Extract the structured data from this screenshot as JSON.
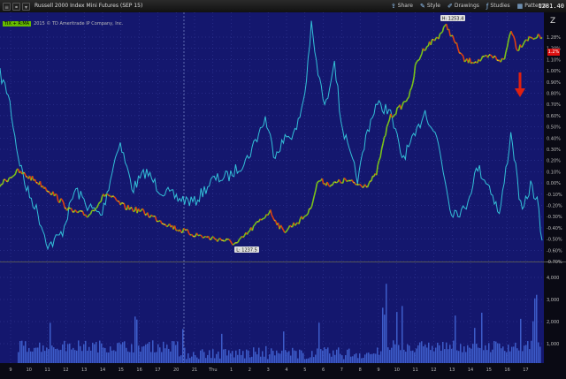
{
  "window": {
    "title": "Russell 2000 Index Mini Futures (SEP 15)",
    "last_price": "1281.40",
    "buttons": [
      {
        "label": "Share",
        "icon": "share-icon",
        "glyph": "⇪"
      },
      {
        "label": "Style",
        "icon": "style-icon",
        "glyph": "✎"
      },
      {
        "label": "Drawings",
        "icon": "drawings-icon",
        "glyph": "✐"
      },
      {
        "label": "Studies",
        "icon": "studies-icon",
        "glyph": "ƒ"
      },
      {
        "label": "Patterns",
        "icon": "patterns-icon",
        "glyph": "▦"
      }
    ]
  },
  "study": {
    "badge": "TIX + R:MA",
    "copyright": "2015 © TD Ameritrade IP Company, Inc."
  },
  "price_tag": "1.2%",
  "high_label": "H: 1253.4",
  "low_label": "L: 1237.5",
  "chart_data": {
    "type": "line",
    "y_axis_ticks": [
      "1.28%",
      "1.20%",
      "1.10%",
      "1.00%",
      "0.90%",
      "0.80%",
      "0.70%",
      "0.60%",
      "0.50%",
      "0.40%",
      "0.30%",
      "0.20%",
      "0.10%",
      "0.00%",
      "-0.10%",
      "-0.20%",
      "-0.30%",
      "-0.40%",
      "-0.50%",
      "-0.60%",
      "-0.70%"
    ],
    "volume_axis_ticks": [
      "4,000",
      "3,000",
      "2,000",
      "1,000"
    ],
    "x_axis_ticks": [
      "9",
      "10",
      "11",
      "12",
      "13",
      "14",
      "15",
      "16",
      "17",
      "20",
      "21",
      "Thu",
      "1",
      "2",
      "3",
      "4",
      "5",
      "6",
      "7",
      "8",
      "9",
      "10",
      "11",
      "12",
      "13",
      "14",
      "15",
      "16",
      "17"
    ],
    "series": [
      {
        "color": "#33c0d8"
      },
      {
        "color_up": "#7ac31a",
        "color_down": "#e04010",
        "color_neutral": "#d8c020"
      }
    ]
  },
  "annotation": {
    "color": "#e02010"
  },
  "colors": {
    "background": "#14176e",
    "grid": "#3a40a0"
  }
}
